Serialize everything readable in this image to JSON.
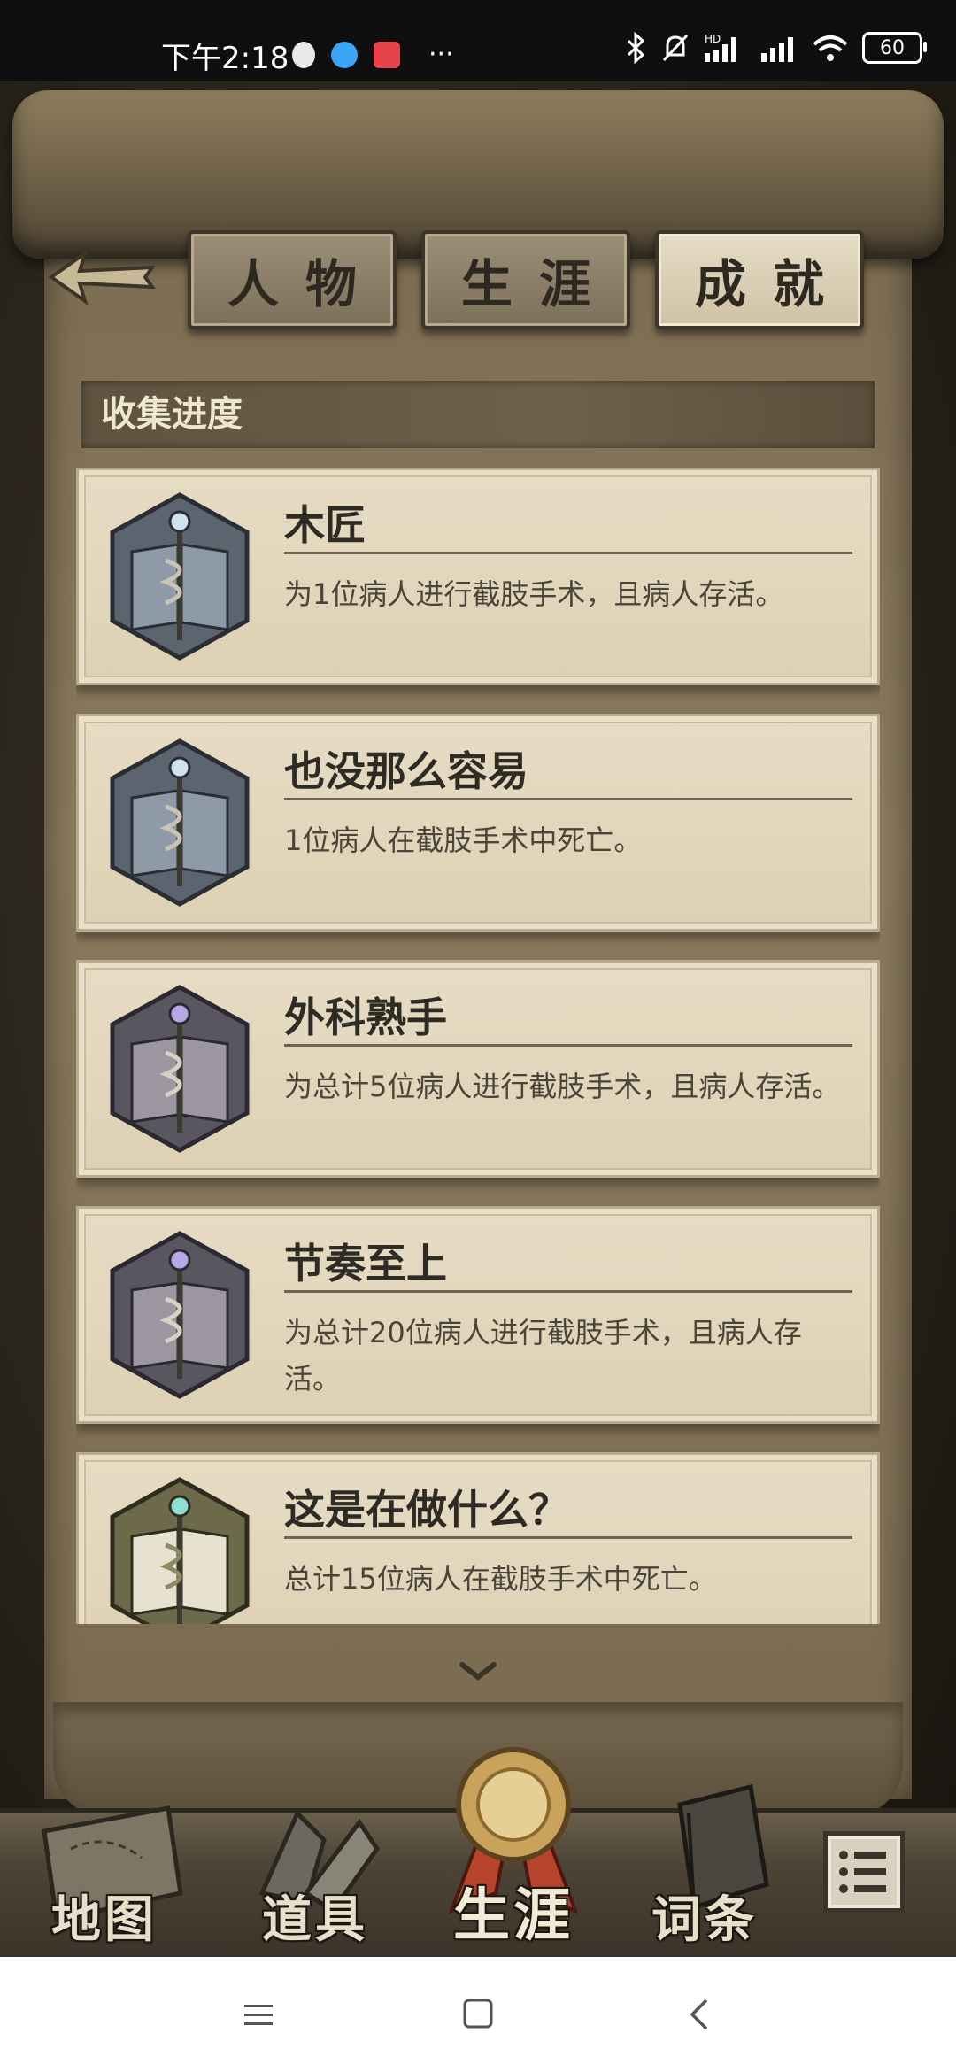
{
  "status_bar": {
    "time": "下午2:18",
    "battery": "60",
    "icons": [
      "qq-icon",
      "browser-icon",
      "app-icon",
      "more-dots-icon",
      "bluetooth-icon",
      "mute-icon",
      "signal-hd-icon",
      "signal-icon",
      "wifi-icon",
      "battery-icon"
    ]
  },
  "tabs": [
    {
      "label": "人物",
      "active": false
    },
    {
      "label": "生涯",
      "active": false
    },
    {
      "label": "成就",
      "active": true
    }
  ],
  "section": {
    "title": "收集进度"
  },
  "achievements": [
    {
      "title": "木匠",
      "description": "为1位病人进行截肢手术，且病人存活。",
      "badge": "silver-book-badge-icon"
    },
    {
      "title": "也没那么容易",
      "description": "1位病人在截肢手术中死亡。",
      "badge": "silver-book-badge-icon"
    },
    {
      "title": "外科熟手",
      "description": "为总计5位病人进行截肢手术，且病人存活。",
      "badge": "purple-book-badge-icon"
    },
    {
      "title": "节奏至上",
      "description": "为总计20位病人进行截肢手术，且病人存活。",
      "badge": "purple-book-badge-icon"
    },
    {
      "title": "这是在做什么？",
      "description": "总计15位病人在截肢手术中死亡。",
      "badge": "gold-book-badge-icon"
    }
  ],
  "bottom_nav": [
    {
      "label": "地图",
      "icon": "map-icon"
    },
    {
      "label": "道具",
      "icon": "items-icon"
    },
    {
      "label": "生涯",
      "icon": "medal-icon",
      "active": true
    },
    {
      "label": "词条",
      "icon": "book-icon"
    }
  ],
  "colors": {
    "parchment": "#e3d8bf",
    "tab_active": "#e6dcc5",
    "tab_inactive": "#8c7f69",
    "text_dark": "#2e2a24"
  }
}
